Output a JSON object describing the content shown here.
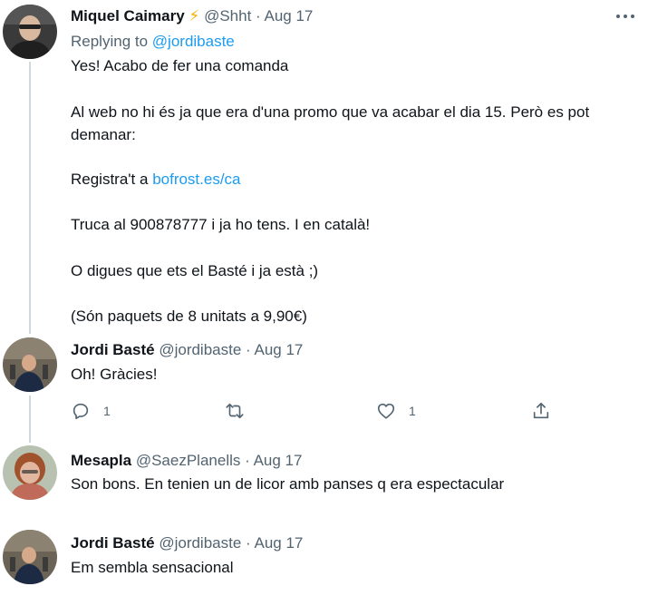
{
  "tweets": [
    {
      "name": "Miquel Caimary",
      "badge": "⚡",
      "handle": "@Shht",
      "date": "Aug 17",
      "replying_label": "Replying to",
      "replying_to": "@jordibaste",
      "lines": {
        "l1": "Yes! Acabo de fer una comanda",
        "l2": "Al web no hi és ja que era d'una promo que va acabar el dia 15. Però es pot",
        "l3": "demanar:",
        "l4_prefix": "Registra't a",
        "l4_link": "bofrost.es/ca",
        "l5": "Truca al 900878777 i ja ho tens. I en català!",
        "l6": "O digues que ets el Basté i ja està ;)",
        "l7": "(Són paquets de 8 unitats a 9,90€)"
      }
    },
    {
      "name": "Jordi Basté",
      "handle": "@jordibaste",
      "date": "Aug 17",
      "text": "Oh! Gràcies!",
      "actions": {
        "reply_count": "1",
        "like_count": "1"
      }
    },
    {
      "name": "Mesapla",
      "handle": "@SaezPlanells",
      "date": "Aug 17",
      "text": "Son bons. En tenien un de licor amb panses q era espectacular"
    },
    {
      "name": "Jordi Basté",
      "handle": "@jordibaste",
      "date": "Aug 17",
      "text": "Em sembla sensacional"
    }
  ],
  "separator": "·",
  "colors": {
    "text": "#0f1419",
    "secondary": "#536471",
    "accent": "#1d9bf0",
    "thread_line": "#cfd9de",
    "badge": "#f4b400"
  },
  "icons": {
    "more": "more-dots-icon",
    "reply": "reply-icon",
    "retweet": "retweet-icon",
    "like": "heart-icon",
    "share": "share-icon"
  }
}
